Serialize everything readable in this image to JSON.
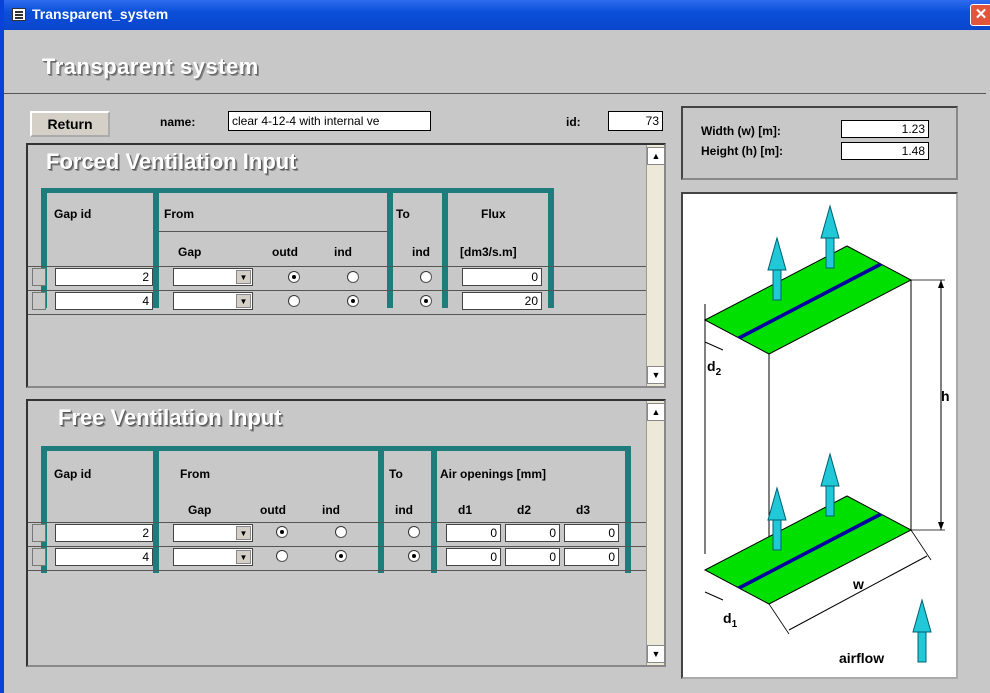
{
  "window": {
    "title": "Transparent_system",
    "close_glyph": "✕"
  },
  "header": {
    "app_title": "Transparent system"
  },
  "top": {
    "return_label": "Return",
    "name_label": "name:",
    "name_value": "clear 4-12-4 with internal ve",
    "id_label": "id:",
    "id_value": "73"
  },
  "dimensions": {
    "width_label": "Width (w) [m]:",
    "width_value": "1.23",
    "height_label": "Height (h) [m]:",
    "height_value": "1.48"
  },
  "forced": {
    "title": "Forced Ventilation Input",
    "headers": {
      "gap_id": "Gap id",
      "from": "From",
      "gap": "Gap",
      "outd": "outd",
      "ind": "ind",
      "to": "To",
      "to_ind": "ind",
      "flux": "Flux",
      "flux_unit": "[dm3/s.m]"
    },
    "rows": [
      {
        "gap_id": "2",
        "from_outd": true,
        "from_ind": false,
        "to_ind": false,
        "flux": "0"
      },
      {
        "gap_id": "4",
        "from_outd": false,
        "from_ind": true,
        "to_ind": true,
        "flux": "20"
      }
    ]
  },
  "free": {
    "title": "Free Ventilation Input",
    "headers": {
      "gap_id": "Gap id",
      "from": "From",
      "gap": "Gap",
      "outd": "outd",
      "ind": "ind",
      "to": "To",
      "to_ind": "ind",
      "air": "Air openings [mm]",
      "d1": "d1",
      "d2": "d2",
      "d3": "d3"
    },
    "rows": [
      {
        "gap_id": "2",
        "from_outd": true,
        "from_ind": false,
        "to_ind": false,
        "d1": "0",
        "d2": "0",
        "d3": "0"
      },
      {
        "gap_id": "4",
        "from_outd": false,
        "from_ind": true,
        "to_ind": true,
        "d1": "0",
        "d2": "0",
        "d3": "0"
      }
    ]
  },
  "diagram": {
    "d2": "d",
    "d2_sub": "2",
    "d1": "d",
    "d1_sub": "1",
    "h": "h",
    "w": "w",
    "airflow": "airflow",
    "colors": {
      "glass": "#00E000",
      "slot": "#0000A0",
      "arrow": "#20C8D8"
    }
  },
  "scroll": {
    "up": "▲",
    "down": "▼"
  }
}
